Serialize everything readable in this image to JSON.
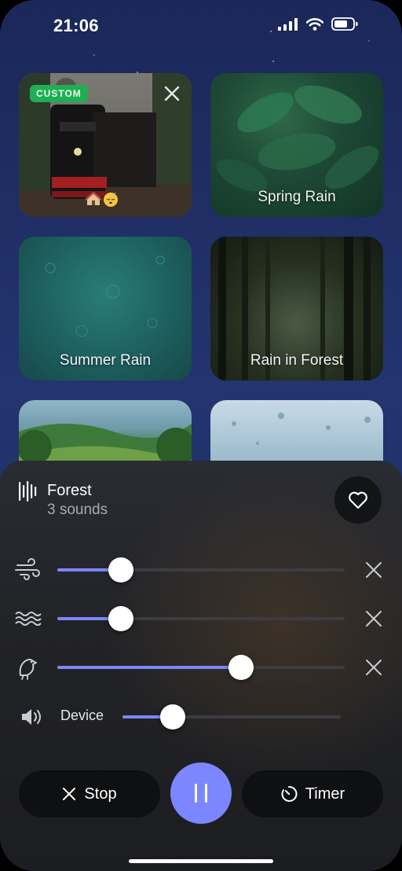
{
  "status_bar": {
    "time": "21:06"
  },
  "cards": [
    {
      "label": "",
      "badge": "CUSTOM"
    },
    {
      "label": "Spring Rain"
    },
    {
      "label": "Summer Rain"
    },
    {
      "label": "Rain in Forest"
    },
    {
      "label": ""
    },
    {
      "label": ""
    }
  ],
  "now_playing": {
    "title": "Forest",
    "subtitle": "3 sounds"
  },
  "mixer": [
    {
      "icon": "wind-icon",
      "level": 0.22
    },
    {
      "icon": "waves-icon",
      "level": 0.22
    },
    {
      "icon": "bird-icon",
      "level": 0.64
    }
  ],
  "device": {
    "label": "Device",
    "level": 0.23
  },
  "controls": {
    "stop_label": "Stop",
    "timer_label": "Timer"
  },
  "colors": {
    "accent": "#7c86ff",
    "custom_badge": "#1fae55"
  }
}
